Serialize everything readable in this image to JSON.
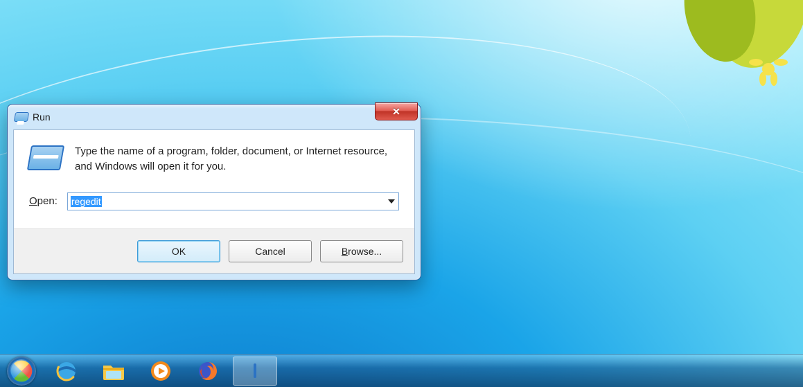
{
  "window": {
    "title": "Run",
    "description": "Type the name of a program, folder, document, or Internet resource, and Windows will open it for you.",
    "open_label_prefix": "O",
    "open_label_rest": "pen:",
    "input_value": "regedit",
    "buttons": {
      "ok": "OK",
      "cancel": "Cancel",
      "browse_prefix": "B",
      "browse_rest": "rowse..."
    }
  },
  "taskbar": {
    "items": [
      {
        "name": "start"
      },
      {
        "name": "internet-explorer"
      },
      {
        "name": "file-explorer"
      },
      {
        "name": "media-player"
      },
      {
        "name": "firefox"
      },
      {
        "name": "run-dialog",
        "active": true
      }
    ]
  }
}
